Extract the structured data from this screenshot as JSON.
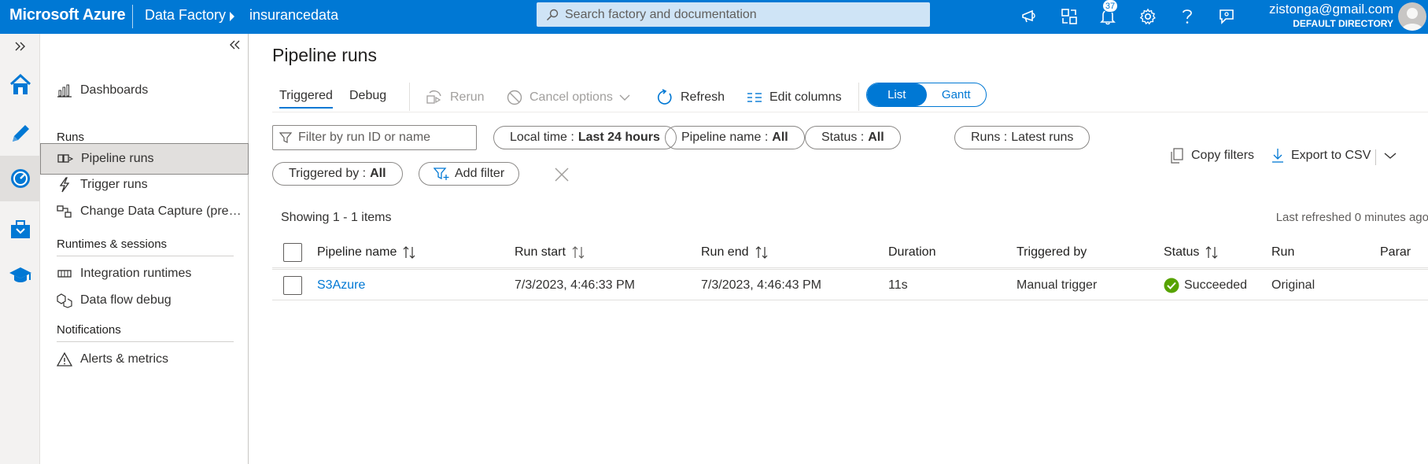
{
  "topbar": {
    "brand": "Microsoft Azure",
    "breadcrumb": [
      "Data Factory",
      "insurancedata"
    ],
    "search_placeholder": "Search factory and documentation",
    "notifications_count": "37",
    "user_email": "zistonga@gmail.com",
    "user_directory": "DEFAULT DIRECTORY",
    "accent_color": "#0078d4"
  },
  "rail": {
    "items": [
      "home-icon",
      "author-pencil-icon",
      "monitor-icon",
      "manage-toolbox-icon",
      "learning-center-icon"
    ]
  },
  "nav": {
    "items": [
      {
        "label": "Dashboards",
        "icon": "dashboard-icon"
      },
      {
        "label": "Pipeline runs",
        "icon": "pipeline-runs-icon"
      },
      {
        "label": "Trigger runs",
        "icon": "trigger-icon"
      },
      {
        "label": "Change Data Capture (previ...",
        "icon": "change-data-capture-icon"
      },
      {
        "label": "Integration runtimes",
        "icon": "integration-runtime-icon"
      },
      {
        "label": "Data flow debug",
        "icon": "data-flow-debug-icon"
      },
      {
        "label": "Alerts & metrics",
        "icon": "alert-icon"
      }
    ],
    "sections": [
      "Runs",
      "Runtimes & sessions",
      "Notifications"
    ]
  },
  "main": {
    "title": "Pipeline runs",
    "tabs": [
      "Triggered",
      "Debug"
    ],
    "commands": {
      "rerun": "Rerun",
      "cancel": "Cancel options",
      "refresh": "Refresh",
      "edit_columns": "Edit columns"
    },
    "view_toggle": [
      "List",
      "Gantt"
    ],
    "filter_placeholder": "Filter by run ID or name",
    "pills": [
      {
        "key": "Local time :",
        "value": "Last 24 hours"
      },
      {
        "key": "Pipeline name :",
        "value": "All"
      },
      {
        "key": "Status :",
        "value": "All"
      },
      {
        "key": "Runs :",
        "value": "Latest runs"
      },
      {
        "key": "Triggered by :",
        "value": "All"
      }
    ],
    "add_filter": "Add filter",
    "copy_filters": "Copy filters",
    "export_csv": "Export to CSV",
    "showing": "Showing 1 - 1 items",
    "last_refreshed": "Last refreshed 0 minutes ago",
    "columns": [
      "Pipeline name",
      "Run start",
      "Run end",
      "Duration",
      "Triggered by",
      "Status",
      "Run",
      "Parar"
    ],
    "rows": [
      {
        "pipeline_name": "S3Azure",
        "run_start": "7/3/2023, 4:46:33 PM",
        "run_end": "7/3/2023, 4:46:43 PM",
        "duration": "11s",
        "triggered_by": "Manual trigger",
        "status": "Succeeded",
        "run": "Original",
        "status_color": "#107c10"
      }
    ]
  }
}
